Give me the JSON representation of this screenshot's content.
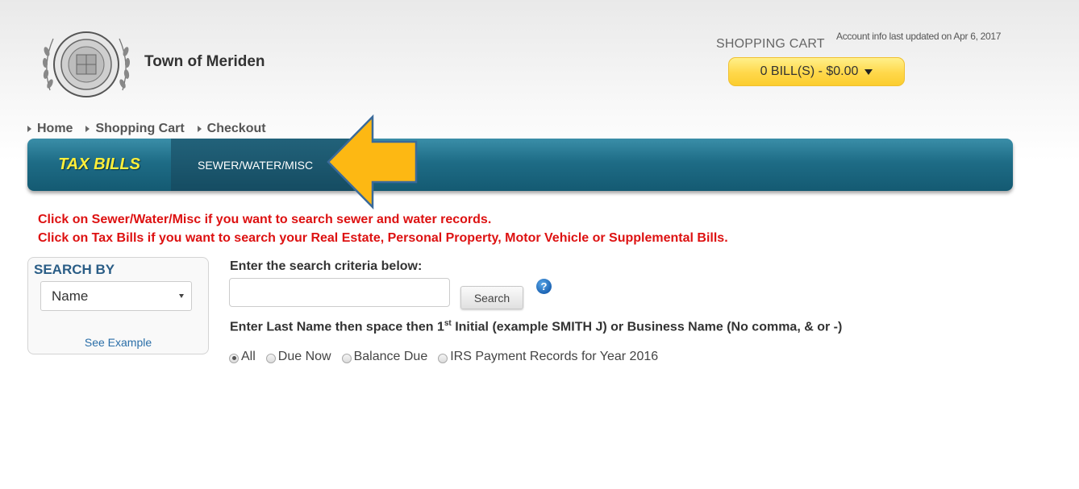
{
  "header": {
    "town_name": "Town of Meriden",
    "cart_label": "SHOPPING CART",
    "account_updated": "Account info last updated on Apr 6, 2017",
    "cart_summary": "0 BILL(S) - $0.00"
  },
  "breadcrumb": {
    "items": [
      {
        "label": "Home"
      },
      {
        "label": "Shopping Cart"
      },
      {
        "label": "Checkout"
      }
    ]
  },
  "nav": {
    "tabs": [
      {
        "label": "TAX BILLS",
        "color": "#ffef3a"
      },
      {
        "label": "SEWER/WATER/MISC",
        "color": "#ffffff"
      }
    ],
    "bar_color": "#1e6c86"
  },
  "annotation": {
    "arrow_color": "#fdb813"
  },
  "instructions": {
    "line1": "Click on Sewer/Water/Misc if you want to search sewer and water records.",
    "line2": "Click on Tax Bills if you want to search your Real Estate, Personal Property, Motor Vehicle or Supplemental Bills.",
    "color": "#dd1111"
  },
  "search_by": {
    "title": "SEARCH BY",
    "selected": "Name",
    "see_example": "See Example"
  },
  "search": {
    "criteria_label": "Enter the search criteria below:",
    "input_value": "",
    "button_label": "Search",
    "help_icon": "?",
    "hint_pre": "Enter Last Name then space then 1",
    "hint_sup": "st",
    "hint_post": " Initial (example SMITH J) or Business Name (No comma, & or -)"
  },
  "filters": {
    "options": [
      {
        "label": "All",
        "checked": true
      },
      {
        "label": "Due Now",
        "checked": false
      },
      {
        "label": "Balance Due",
        "checked": false
      },
      {
        "label": "IRS Payment Records for Year 2016",
        "checked": false
      }
    ]
  }
}
